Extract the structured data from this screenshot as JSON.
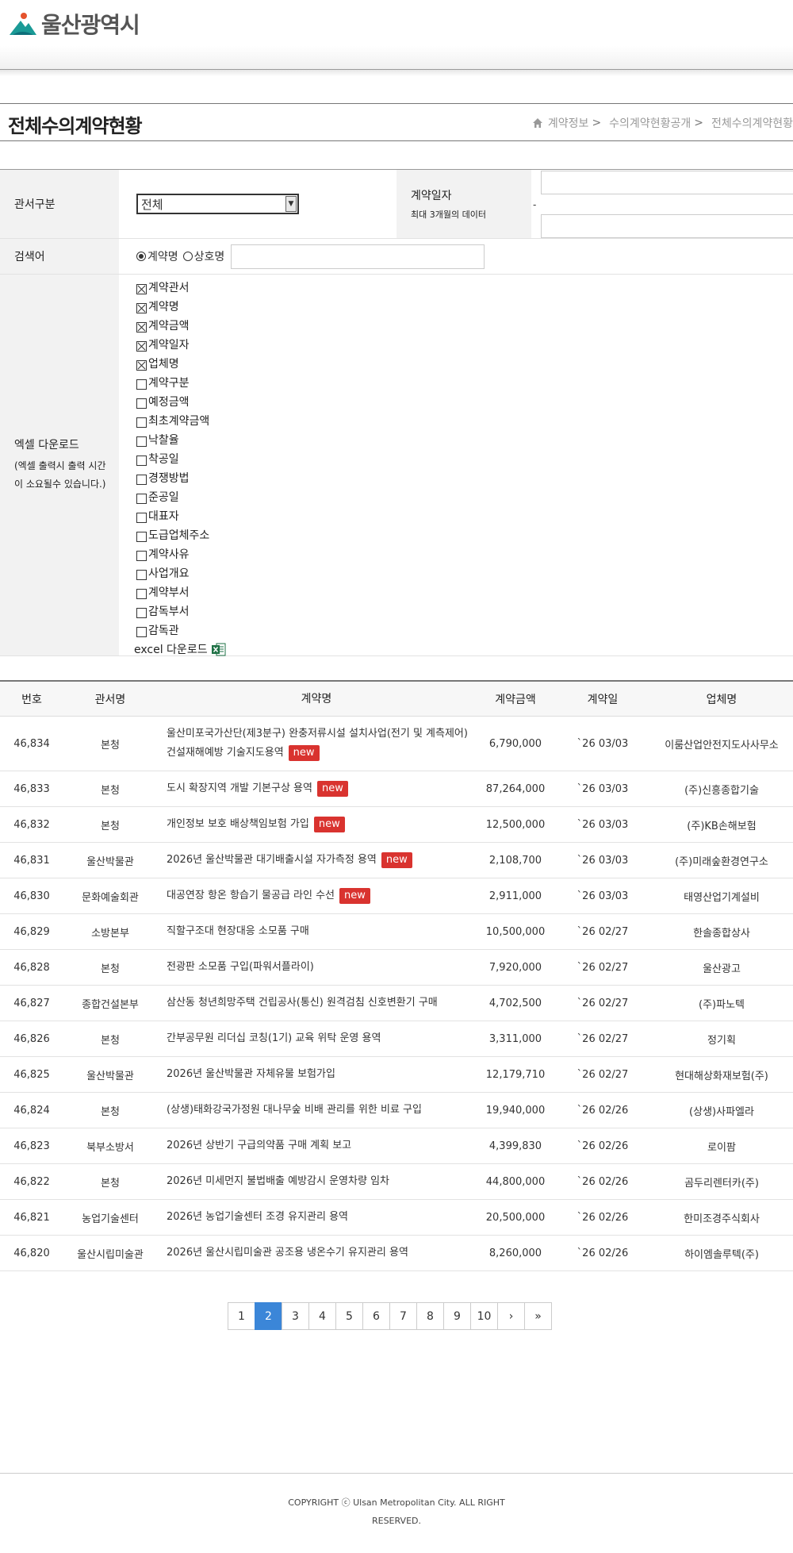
{
  "header": {
    "logo_text": "울산광역시"
  },
  "title": {
    "page_title": "전체수의계약현황",
    "breadcrumb": [
      "계약정보",
      "수의계약현황공개",
      "전체수의계약현황"
    ]
  },
  "form": {
    "org_label": "관서구분",
    "org_selected": "전체",
    "date_label": "계약일자",
    "date_hint": "최대 3개월의 데이터",
    "date_dash": "-",
    "keyword_label": "검색어",
    "radio_contract": "계약명",
    "radio_company": "상호명",
    "excel_label": "엑셀 다운로드",
    "excel_hint_1": "(엑셀 출력시 출력 시간",
    "excel_hint_2": "이 소요될수 있습니다.)",
    "checkboxes": [
      {
        "label": "계약관서",
        "checked": true
      },
      {
        "label": "계약명",
        "checked": true
      },
      {
        "label": "계약금액",
        "checked": true
      },
      {
        "label": "계약일자",
        "checked": true
      },
      {
        "label": "업체명",
        "checked": true
      },
      {
        "label": "계약구분",
        "checked": false
      },
      {
        "label": "예정금액",
        "checked": false
      },
      {
        "label": "최초계약금액",
        "checked": false
      },
      {
        "label": "낙찰율",
        "checked": false
      },
      {
        "label": "착공일",
        "checked": false
      },
      {
        "label": "경쟁방법",
        "checked": false
      },
      {
        "label": "준공일",
        "checked": false
      },
      {
        "label": "대표자",
        "checked": false
      },
      {
        "label": "도급업체주소",
        "checked": false
      },
      {
        "label": "계약사유",
        "checked": false
      },
      {
        "label": "사업개요",
        "checked": false
      },
      {
        "label": "계약부서",
        "checked": false
      },
      {
        "label": "감독부서",
        "checked": false
      },
      {
        "label": "감독관",
        "checked": false
      }
    ],
    "excel_download": "excel 다운로드"
  },
  "table": {
    "headers": {
      "no": "번호",
      "org": "관서명",
      "name": "계약명",
      "amount": "계약금액",
      "date": "계약일",
      "vendor": "업체명"
    },
    "badge_text": "new",
    "rows": [
      {
        "no": "46,834",
        "org": "본청",
        "name": "울산미포국가산단(제3분구) 완충저류시설 설치사업(전기 및 계측제어) 건설재해예방 기술지도용역",
        "amount": "6,790,000",
        "date": "`26 03/03",
        "vendor": "이룸산업안전지도사사무소",
        "isNew": true
      },
      {
        "no": "46,833",
        "org": "본청",
        "name": "도시 확장지역 개발 기본구상 용역",
        "amount": "87,264,000",
        "date": "`26 03/03",
        "vendor": "(주)신흥종합기술",
        "isNew": true
      },
      {
        "no": "46,832",
        "org": "본청",
        "name": "개인정보 보호 배상책임보험 가입",
        "amount": "12,500,000",
        "date": "`26 03/03",
        "vendor": "(주)KB손해보험",
        "isNew": true
      },
      {
        "no": "46,831",
        "org": "울산박물관",
        "name": "2026년 울산박물관 대기배출시설 자가측정 용역",
        "amount": "2,108,700",
        "date": "`26 03/03",
        "vendor": "(주)미래숲환경연구소",
        "isNew": true
      },
      {
        "no": "46,830",
        "org": "문화예술회관",
        "name": "대공연장 항온 항습기 물공급 라인 수선",
        "amount": "2,911,000",
        "date": "`26 03/03",
        "vendor": "태영산업기계설비",
        "isNew": true
      },
      {
        "no": "46,829",
        "org": "소방본부",
        "name": "직할구조대 현장대응 소모품 구매",
        "amount": "10,500,000",
        "date": "`26 02/27",
        "vendor": "한솔종합상사",
        "isNew": false
      },
      {
        "no": "46,828",
        "org": "본청",
        "name": "전광판 소모품 구입(파워서플라이)",
        "amount": "7,920,000",
        "date": "`26 02/27",
        "vendor": "울산광고",
        "isNew": false
      },
      {
        "no": "46,827",
        "org": "종합건설본부",
        "name": "삼산동 청년희망주택 건립공사(통신) 원격검침 신호변환기 구매",
        "amount": "4,702,500",
        "date": "`26 02/27",
        "vendor": "(주)파노텍",
        "isNew": false
      },
      {
        "no": "46,826",
        "org": "본청",
        "name": "간부공무원 리더십 코칭(1기) 교육 위탁 운영 용역",
        "amount": "3,311,000",
        "date": "`26 02/27",
        "vendor": "정기획",
        "isNew": false
      },
      {
        "no": "46,825",
        "org": "울산박물관",
        "name": "2026년 울산박물관 자체유물 보험가입",
        "amount": "12,179,710",
        "date": "`26 02/27",
        "vendor": "현대해상화재보험(주)",
        "isNew": false
      },
      {
        "no": "46,824",
        "org": "본청",
        "name": "(상생)태화강국가정원 대나무숲 비배 관리를 위한 비료 구입",
        "amount": "19,940,000",
        "date": "`26 02/26",
        "vendor": "(상생)사파엘라",
        "isNew": false
      },
      {
        "no": "46,823",
        "org": "북부소방서",
        "name": "2026년 상반기 구급의약품 구매 계획 보고",
        "amount": "4,399,830",
        "date": "`26 02/26",
        "vendor": "로이팜",
        "isNew": false
      },
      {
        "no": "46,822",
        "org": "본청",
        "name": "2026년 미세먼지 불법배출 예방감시 운영차량 임차",
        "amount": "44,800,000",
        "date": "`26 02/26",
        "vendor": "곰두리렌터카(주)",
        "isNew": false
      },
      {
        "no": "46,821",
        "org": "농업기술센터",
        "name": "2026년 농업기술센터 조경 유지관리 용역",
        "amount": "20,500,000",
        "date": "`26 02/26",
        "vendor": "한미조경주식회사",
        "isNew": false
      },
      {
        "no": "46,820",
        "org": "울산시립미술관",
        "name": "2026년 울산시립미술관 공조용 냉온수기 유지관리 용역",
        "amount": "8,260,000",
        "date": "`26 02/26",
        "vendor": "하이엠솔루텍(주)",
        "isNew": false
      }
    ]
  },
  "pagination": {
    "pages": [
      "1",
      "2",
      "3",
      "4",
      "5",
      "6",
      "7",
      "8",
      "9",
      "10"
    ],
    "current": "2",
    "next": "›",
    "last": "»"
  },
  "footer": {
    "copyright_1": "COPYRIGHT ⓒ Ulsan Metropolitan City. ALL RIGHT",
    "copyright_2": "RESERVED."
  },
  "colors": {
    "badge": "#d9332f",
    "active_page": "#3b86d8",
    "logo_teal": "#1a9a96"
  }
}
